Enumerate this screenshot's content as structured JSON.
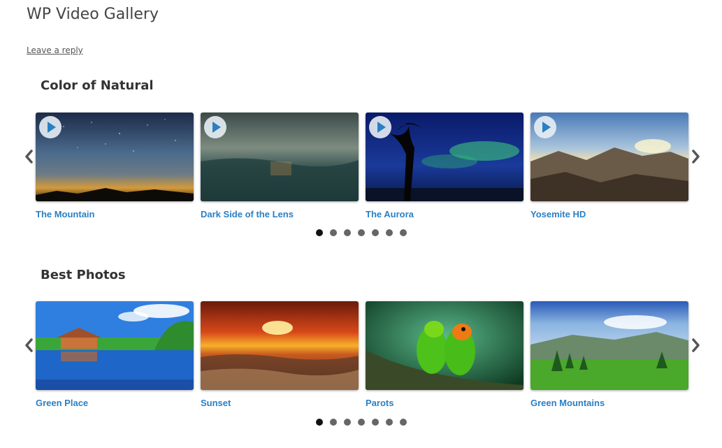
{
  "post": {
    "title": "WP Video Gallery",
    "reply_link": "Leave a reply"
  },
  "galleries": [
    {
      "title": "Color of Natural",
      "items": [
        {
          "caption": "The Mountain",
          "has_play": true
        },
        {
          "caption": "Dark Side of the Lens",
          "has_play": true
        },
        {
          "caption": "The Aurora",
          "has_play": true
        },
        {
          "caption": "Yosemite HD",
          "has_play": true
        }
      ],
      "pagination": {
        "pages": 7,
        "current": 1
      }
    },
    {
      "title": "Best Photos",
      "items": [
        {
          "caption": "Green Place",
          "has_play": false
        },
        {
          "caption": "Sunset",
          "has_play": false
        },
        {
          "caption": "Parots",
          "has_play": false
        },
        {
          "caption": "Green Mountains",
          "has_play": false
        }
      ],
      "pagination": {
        "pages": 7,
        "current": 1
      }
    }
  ],
  "icons": {
    "prev": "chevron-left-icon",
    "next": "chevron-right-icon",
    "play": "play-icon"
  },
  "colors": {
    "caption_link": "#2a7fc4",
    "dot_active": "#111111",
    "dot_inactive": "#666666"
  }
}
